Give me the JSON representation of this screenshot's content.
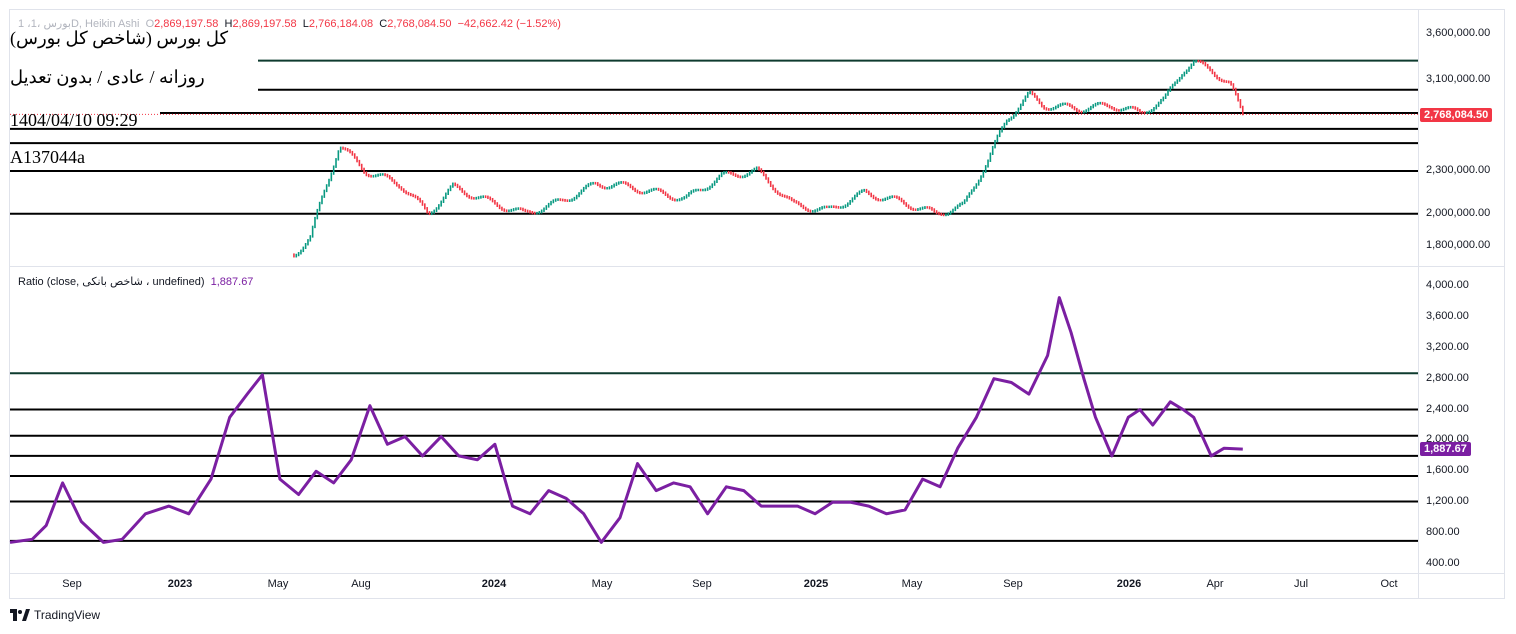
{
  "header": {
    "prefix": "1 ،بورس ،1D, Heikin Ashi",
    "o_label": "O",
    "o_value": "2,869,197.58",
    "h_label": "H",
    "h_value": "2,869,197.58",
    "l_label": "L",
    "l_value": "2,766,184.08",
    "c_label": "C",
    "c_value": "2,768,084.50",
    "change": "−42,662.42 (−1.52%)"
  },
  "overlay_labels": {
    "name": "(کل بورس (شاخص کل بورس",
    "timeframe": "روزانه / عادی / بدون تعدیل",
    "datetime": "1404/04/10 09:29",
    "code": "A137044a"
  },
  "indicator": {
    "label": "Ratio (close, شاخص بانکی ، undefined)",
    "value": "1,887.67"
  },
  "price_badge": "2,768,084.50",
  "ratio_badge": "1,887.67",
  "colors": {
    "up": "#089981",
    "down": "#f23645",
    "ratio_line": "#7b1fa2",
    "price_badge_bg": "#f23645",
    "ratio_badge_bg": "#7b1fa2",
    "top_line": "#0e3b2f"
  },
  "branding": {
    "text": "TradingView",
    "icon": "tradingview-logo-icon"
  },
  "chart_data": [
    {
      "type": "candlestick",
      "style": "Heikin Ashi",
      "y_ticks": [
        "3,600,000.00",
        "3,100,000.00",
        "2,300,000.00",
        "2,000,000.00",
        "1,800,000.00"
      ],
      "y_tick_values": [
        3600000,
        3100000,
        2300000,
        2000000,
        1800000
      ],
      "ylim": [
        1700000,
        3800000
      ],
      "scale": "log",
      "horizontal_levels": [
        3300000,
        3000000,
        2780000,
        2640000,
        2520000,
        2300000,
        2000000
      ],
      "x": [
        "2023-04-01",
        "2023-04-15",
        "2023-05-01",
        "2023-05-10",
        "2023-06-01",
        "2023-07-01",
        "2023-07-25",
        "2023-08-15",
        "2023-09-15",
        "2023-10-15",
        "2023-11-15",
        "2023-12-15",
        "2024-01-01",
        "2024-02-01",
        "2024-03-01",
        "2024-04-01",
        "2024-05-01",
        "2024-06-01",
        "2024-07-01",
        "2024-08-01",
        "2024-09-01",
        "2024-10-01",
        "2024-10-25",
        "2024-11-15",
        "2024-12-01",
        "2024-12-20",
        "2025-01-01",
        "2025-02-01",
        "2025-03-01",
        "2025-03-25",
        "2025-04-15",
        "2025-05-01",
        "2025-05-10",
        "2025-05-25",
        "2025-06-10",
        "2025-06-21"
      ],
      "values": [
        1750000,
        1850000,
        2250000,
        2500000,
        2300000,
        2200000,
        2000000,
        2180000,
        2080000,
        2000000,
        2080000,
        2200000,
        2200000,
        2150000,
        2100000,
        2260000,
        2300000,
        2060000,
        2020000,
        2140000,
        2080000,
        2000000,
        2050000,
        2380000,
        2720000,
        2950000,
        2850000,
        2820000,
        2850000,
        2780000,
        2900000,
        3200000,
        3280000,
        3200000,
        3050000,
        2768084.5
      ]
    },
    {
      "type": "line",
      "series": [
        {
          "name": "Ratio (close, شاخص بانکی ، undefined)",
          "last": 1887.67
        }
      ],
      "y_ticks": [
        "4,000.00",
        "3,600.00",
        "3,200.00",
        "2,800.00",
        "2,400.00",
        "2,000.00",
        "1,600.00",
        "1,200.00",
        "800.00",
        "400.00"
      ],
      "y_tick_values": [
        4000,
        3600,
        3200,
        2800,
        2400,
        2000,
        1600,
        1200,
        800,
        400
      ],
      "ylim": [
        300,
        4100
      ],
      "horizontal_levels": [
        2870,
        2400,
        2060,
        1800,
        1540,
        1210,
        700
      ],
      "x": [
        "2022-08-01",
        "2022-08-20",
        "2022-09-01",
        "2022-09-15",
        "2022-10-01",
        "2022-10-20",
        "2022-11-05",
        "2022-11-25",
        "2022-12-15",
        "2023-01-01",
        "2023-01-20",
        "2023-02-05",
        "2023-02-20",
        "2023-03-05",
        "2023-03-20",
        "2023-04-05",
        "2023-04-20",
        "2023-05-05",
        "2023-05-20",
        "2023-06-05",
        "2023-06-20",
        "2023-07-05",
        "2023-07-20",
        "2023-08-05",
        "2023-08-20",
        "2023-09-05",
        "2023-09-20",
        "2023-10-05",
        "2023-10-20",
        "2023-11-05",
        "2023-11-20",
        "2023-12-05",
        "2023-12-20",
        "2024-01-05",
        "2024-01-20",
        "2024-02-05",
        "2024-02-20",
        "2024-03-05",
        "2024-03-20",
        "2024-04-05",
        "2024-04-20",
        "2024-05-05",
        "2024-05-20",
        "2024-06-05",
        "2024-06-20",
        "2024-07-05",
        "2024-07-20",
        "2024-08-05",
        "2024-08-20",
        "2024-09-05",
        "2024-09-20",
        "2024-10-05",
        "2024-10-20",
        "2024-11-05",
        "2024-11-20",
        "2024-12-05",
        "2024-12-20",
        "2025-01-05",
        "2025-01-15",
        "2025-01-25",
        "2025-02-05",
        "2025-02-15",
        "2025-03-01",
        "2025-03-15",
        "2025-03-25",
        "2025-04-05",
        "2025-04-20",
        "2025-05-01",
        "2025-05-10",
        "2025-05-25",
        "2025-06-05",
        "2025-06-21"
      ],
      "values": [
        680,
        720,
        900,
        1450,
        950,
        680,
        720,
        1050,
        1150,
        1050,
        1500,
        2300,
        2600,
        2850,
        1500,
        1300,
        1600,
        1450,
        1750,
        2450,
        1950,
        2050,
        1800,
        2050,
        1800,
        1750,
        1950,
        1150,
        1050,
        1350,
        1250,
        1050,
        680,
        1000,
        1700,
        1350,
        1450,
        1400,
        1050,
        1400,
        1350,
        1150,
        1150,
        1150,
        1050,
        1200,
        1200,
        1150,
        1050,
        1100,
        1500,
        1400,
        1900,
        2300,
        2800,
        2750,
        2600,
        3100,
        3850,
        3400,
        2800,
        2300,
        1800,
        2300,
        2400,
        2200,
        2500,
        2400,
        2300,
        1800,
        1900,
        1887.67
      ]
    }
  ],
  "x_axis_ticks": [
    {
      "label": "Sep",
      "bold": false
    },
    {
      "label": "2023",
      "bold": true
    },
    {
      "label": "May",
      "bold": false
    },
    {
      "label": "Aug",
      "bold": false
    },
    {
      "label": "2024",
      "bold": true
    },
    {
      "label": "May",
      "bold": false
    },
    {
      "label": "Sep",
      "bold": false
    },
    {
      "label": "2025",
      "bold": true
    },
    {
      "label": "May",
      "bold": false
    },
    {
      "label": "Sep",
      "bold": false
    },
    {
      "label": "2026",
      "bold": true
    },
    {
      "label": "Apr",
      "bold": false
    },
    {
      "label": "Jul",
      "bold": false
    },
    {
      "label": "Oct",
      "bold": false
    }
  ]
}
